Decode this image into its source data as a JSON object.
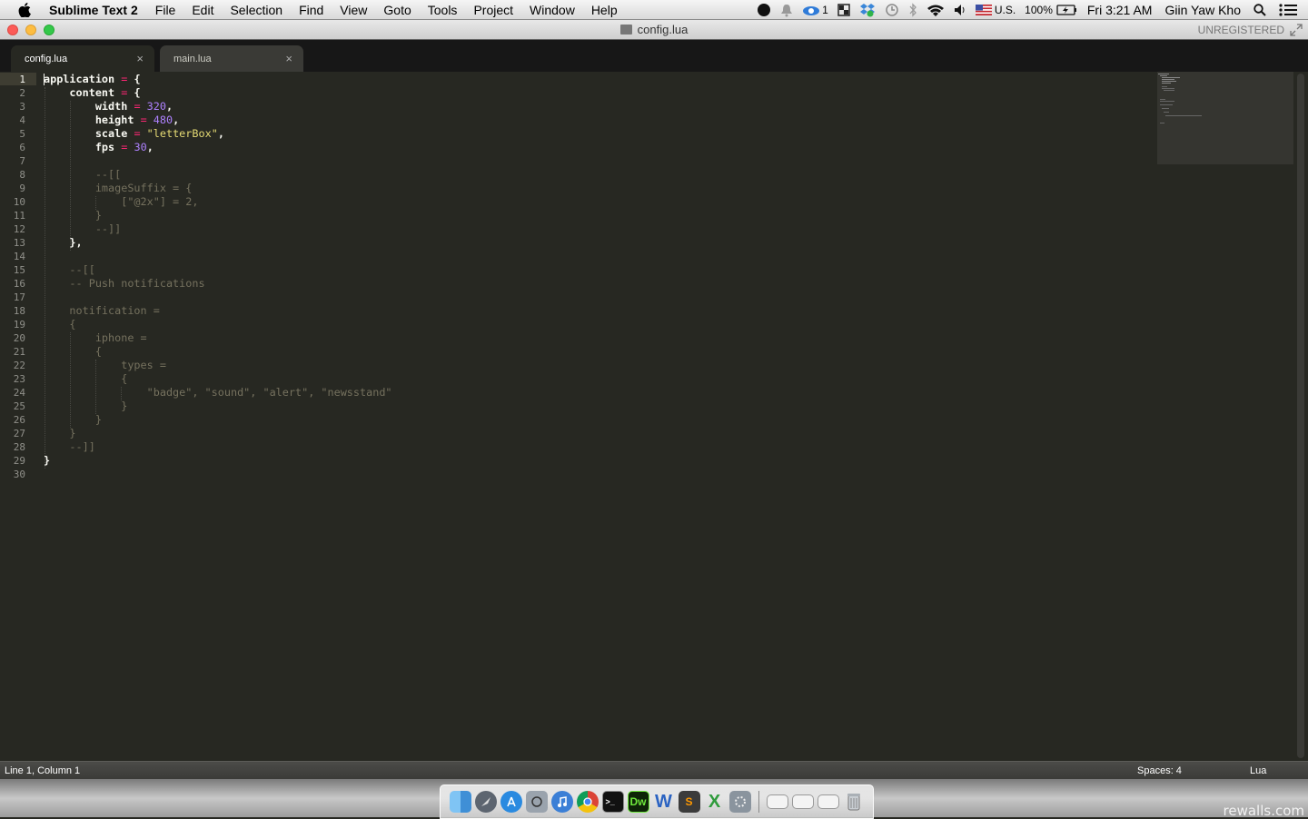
{
  "menubar": {
    "app_name": "Sublime Text 2",
    "items": [
      "File",
      "Edit",
      "Selection",
      "Find",
      "View",
      "Goto",
      "Tools",
      "Project",
      "Window",
      "Help"
    ],
    "status": {
      "cloud_count": "1",
      "input_source": "U.S.",
      "battery": "100%",
      "clock": "Fri 3:21 AM",
      "user": "Giin Yaw Kho"
    }
  },
  "window": {
    "title": "config.lua",
    "unregistered": "UNREGISTERED"
  },
  "tabs": [
    {
      "label": "config.lua",
      "close": "×",
      "active": true
    },
    {
      "label": "main.lua",
      "close": "×",
      "active": false
    }
  ],
  "editor": {
    "current_line": 1,
    "line_numbers": [
      "1",
      "2",
      "3",
      "4",
      "5",
      "6",
      "7",
      "8",
      "9",
      "10",
      "11",
      "12",
      "13",
      "14",
      "15",
      "16",
      "17",
      "18",
      "19",
      "20",
      "21",
      "22",
      "23",
      "24",
      "25",
      "26",
      "27",
      "28",
      "29",
      "30"
    ]
  },
  "statusbar": {
    "position": "Line 1, Column 1",
    "indentation": "Spaces: 4",
    "syntax": "Lua"
  },
  "dock": {
    "icons": [
      "finder-icon",
      "launchpad-icon",
      "app-store-icon",
      "preview-icon",
      "itunes-icon",
      "chrome-icon",
      "terminal-icon",
      "dreamweaver-icon",
      "word-icon",
      "sublime-icon",
      "excel-icon",
      "system-preferences-icon"
    ],
    "dreamweaver_label": "Dw",
    "word_label": "W",
    "sublime_label": "S",
    "excel_label": "X"
  },
  "watermark": "rewalls.com",
  "colors": {
    "editor_bg": "#272822",
    "comment": "#75715e",
    "number": "#ae81ff",
    "string": "#e6db74",
    "operator": "#f92672"
  }
}
